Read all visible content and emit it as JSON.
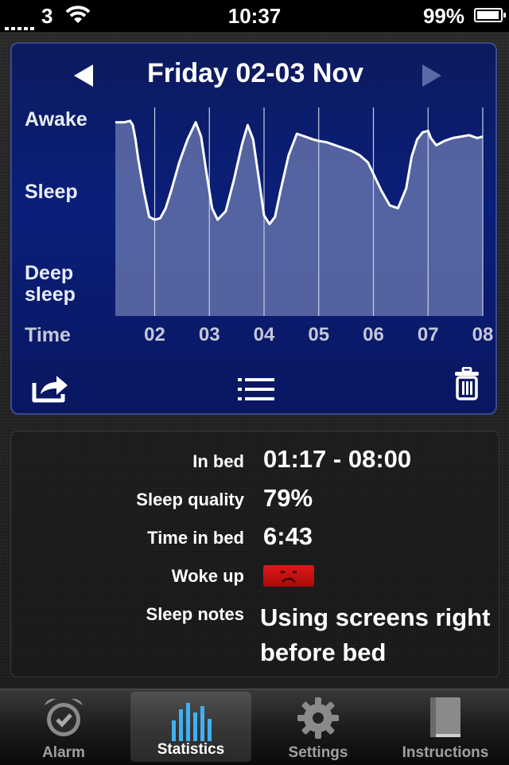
{
  "status_bar": {
    "carrier": "3",
    "time": "10:37",
    "battery": "99%"
  },
  "chart_panel": {
    "date_title": "Friday 02-03 Nov",
    "colors": {
      "background": "#0a1f7a",
      "line": "#ffffff",
      "fill": "#6e7bb0"
    }
  },
  "chart_data": {
    "type": "area",
    "title": "Friday 02-03 Nov",
    "xlabel": "Time",
    "ylabel": "",
    "y_categories": [
      "Awake",
      "Sleep",
      "Deep sleep"
    ],
    "y_category_labels": [
      "Awake",
      "Sleep",
      "Deep\nsleep"
    ],
    "x_ticks": [
      "02",
      "03",
      "04",
      "05",
      "06",
      "07",
      "08"
    ],
    "xlim": [
      1.28,
      8.0
    ],
    "ylim": [
      0,
      1
    ],
    "grid": true,
    "series": [
      {
        "x": [
          1.28,
          1.45,
          1.55,
          1.6,
          1.65,
          1.7,
          1.8,
          1.9,
          2.0,
          2.1,
          2.2,
          2.3,
          2.45,
          2.6,
          2.75,
          2.85,
          2.95,
          3.05,
          3.15,
          3.3,
          3.45,
          3.6,
          3.7,
          3.8,
          3.9,
          4.0,
          4.1,
          4.2,
          4.3,
          4.45,
          4.6,
          4.75,
          4.9,
          5.0,
          5.15,
          5.3,
          5.45,
          5.6,
          5.75,
          5.9,
          6.0,
          6.15,
          6.3,
          6.45,
          6.6,
          6.7,
          6.8,
          6.9,
          7.0,
          7.05,
          7.15,
          7.3,
          7.45,
          7.6,
          7.75,
          7.9,
          8.0
        ],
        "y": [
          0.98,
          0.98,
          0.99,
          0.96,
          0.86,
          0.72,
          0.5,
          0.32,
          0.3,
          0.31,
          0.38,
          0.5,
          0.7,
          0.86,
          0.98,
          0.88,
          0.62,
          0.38,
          0.3,
          0.36,
          0.58,
          0.83,
          0.96,
          0.86,
          0.6,
          0.33,
          0.27,
          0.32,
          0.5,
          0.75,
          0.9,
          0.88,
          0.86,
          0.85,
          0.84,
          0.82,
          0.8,
          0.78,
          0.75,
          0.7,
          0.62,
          0.5,
          0.4,
          0.38,
          0.52,
          0.74,
          0.86,
          0.91,
          0.92,
          0.87,
          0.82,
          0.85,
          0.87,
          0.88,
          0.89,
          0.87,
          0.88
        ]
      }
    ]
  },
  "summary": {
    "in_bed_label": "In bed",
    "in_bed_value": "01:17 - 08:00",
    "quality_label": "Sleep quality",
    "quality_value": "79%",
    "time_label": "Time in bed",
    "time_value": "6:43",
    "woke_label": "Woke up",
    "woke_mood_icon": "sad-face-icon",
    "notes_label": "Sleep notes",
    "notes_value": "Using screens right before bed"
  },
  "tabs": [
    {
      "label": "Alarm",
      "icon": "alarm-clock-icon",
      "active": false
    },
    {
      "label": "Statistics",
      "icon": "bar-chart-icon",
      "active": true
    },
    {
      "label": "Settings",
      "icon": "gear-icon",
      "active": false
    },
    {
      "label": "Instructions",
      "icon": "book-icon",
      "active": false
    }
  ]
}
